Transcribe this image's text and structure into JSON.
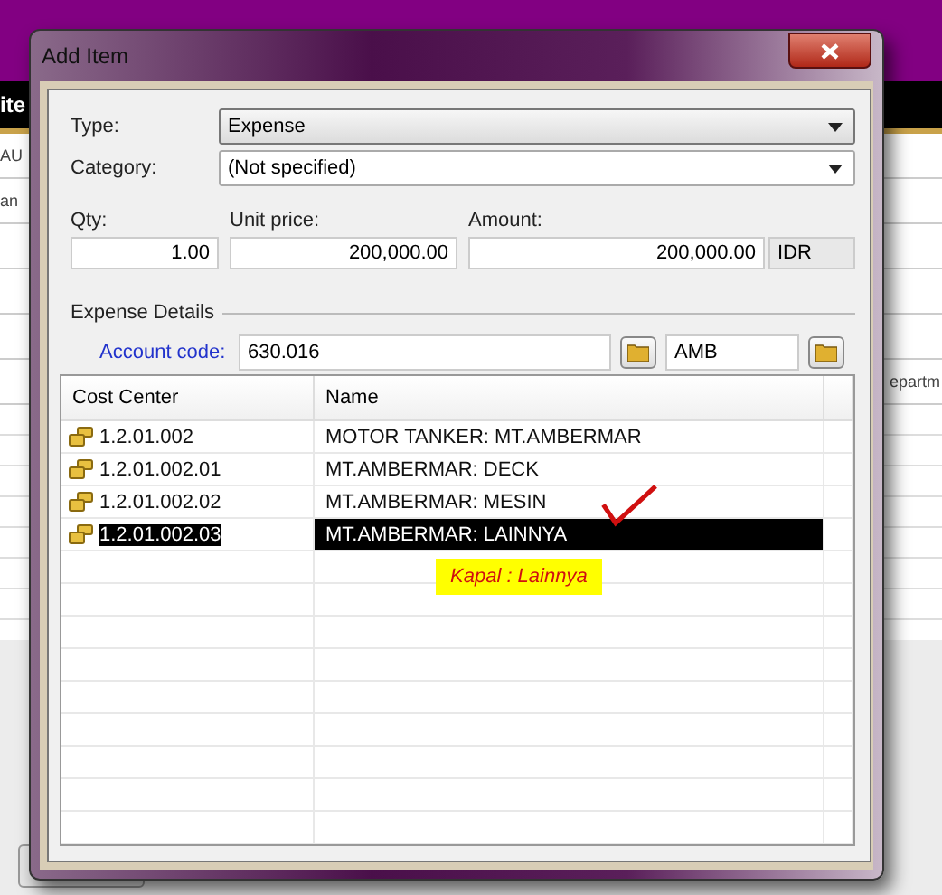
{
  "background": {
    "header": "ite",
    "left_fragments": [
      "AU",
      "an"
    ],
    "right_fragment": "epartm"
  },
  "window": {
    "title": "Add Item"
  },
  "form": {
    "type": {
      "label": "Type:",
      "value": "Expense"
    },
    "category": {
      "label": "Category:",
      "value": "(Not specified)"
    },
    "qty": {
      "label": "Qty:",
      "value": "1.00"
    },
    "unit_price": {
      "label": "Unit price:",
      "value": "200,000.00"
    },
    "amount": {
      "label": "Amount:",
      "value": "200,000.00",
      "currency": "IDR"
    }
  },
  "expense_details": {
    "title": "Expense Details",
    "account_code": {
      "label": "Account code:",
      "value": "630.016",
      "search": "AMB"
    }
  },
  "table": {
    "columns": [
      "Cost Center",
      "Name"
    ],
    "rows": [
      {
        "cost_center": "1.2.01.002",
        "name": "MOTOR TANKER: MT.AMBERMAR",
        "selected": false
      },
      {
        "cost_center": "1.2.01.002.01",
        "name": "MT.AMBERMAR: DECK",
        "selected": false
      },
      {
        "cost_center": "1.2.01.002.02",
        "name": "MT.AMBERMAR: MESIN",
        "selected": false
      },
      {
        "cost_center": "1.2.01.002.03",
        "name": "MT.AMBERMAR: LAINNYA",
        "selected": true
      }
    ]
  },
  "annotation": {
    "text": "Kapal : Lainnya"
  }
}
